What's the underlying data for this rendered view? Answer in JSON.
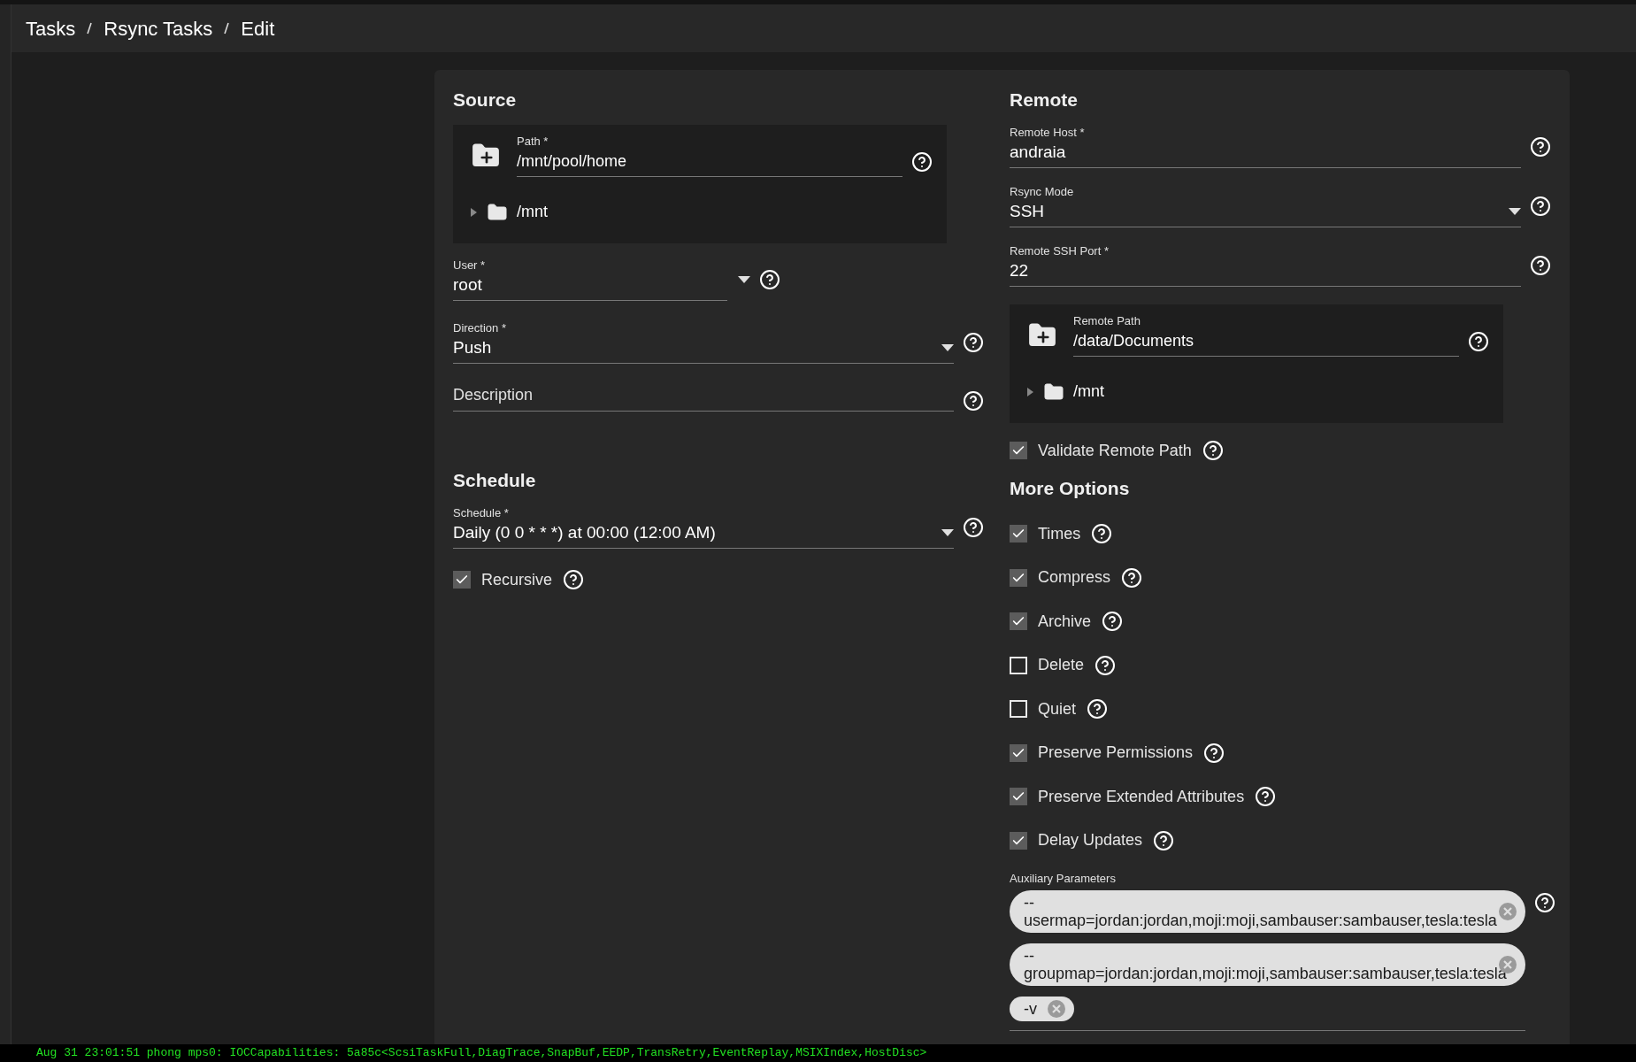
{
  "breadcrumb": [
    "Tasks",
    "Rsync Tasks",
    "Edit"
  ],
  "source": {
    "title": "Source",
    "path": {
      "label": "Path *",
      "value": "/mnt/pool/home",
      "tree": [
        {
          "label": "/mnt",
          "expanded": false
        }
      ]
    },
    "fields": [
      {
        "kind": "short_select",
        "label": "User *",
        "value": "root"
      },
      {
        "kind": "select",
        "label": "Direction *",
        "value": "Push"
      },
      {
        "kind": "text",
        "placeholder": "Description"
      }
    ]
  },
  "schedule": {
    "title": "Schedule",
    "field": {
      "label": "Schedule *",
      "value": "Daily (0 0 * * *) at 00:00 (12:00 AM)"
    },
    "checkboxes": [
      {
        "label": "Recursive",
        "checked": true
      }
    ]
  },
  "remote": {
    "title": "Remote",
    "fields": [
      {
        "kind": "text",
        "label": "Remote Host *",
        "value": "andraia"
      },
      {
        "kind": "select",
        "label": "Rsync Mode",
        "value": "SSH"
      },
      {
        "kind": "text",
        "label": "Remote SSH Port *",
        "value": "22"
      }
    ],
    "path": {
      "label": "Remote Path",
      "value": "/data/Documents",
      "tree": [
        {
          "label": "/mnt",
          "expanded": false
        }
      ]
    },
    "checkboxes": [
      {
        "label": "Validate Remote Path",
        "checked": true
      }
    ]
  },
  "more_options": {
    "title": "More Options",
    "checkboxes": [
      {
        "label": "Times",
        "checked": true
      },
      {
        "label": "Compress",
        "checked": true
      },
      {
        "label": "Archive",
        "checked": true
      },
      {
        "label": "Delete",
        "checked": false
      },
      {
        "label": "Quiet",
        "checked": false
      },
      {
        "label": "Preserve Permissions",
        "checked": true
      },
      {
        "label": "Preserve Extended Attributes",
        "checked": true
      },
      {
        "label": "Delay Updates",
        "checked": true
      }
    ],
    "auxiliary": {
      "label": "Auxiliary Parameters",
      "chips": [
        "--usermap=jordan:jordan,moji:moji,sambauser:sambauser,tesla:tesla",
        "--groupmap=jordan:jordan,moji:moji,sambauser:sambauser,tesla:tesla",
        "-v"
      ]
    }
  },
  "console": "Aug 31 23:01:51 phong mps0: IOCCapabilities: 5a85c<ScsiTaskFull,DiagTrace,SnapBuf,EEDP,TransRetry,EventReplay,MSIXIndex,HostDisc>"
}
